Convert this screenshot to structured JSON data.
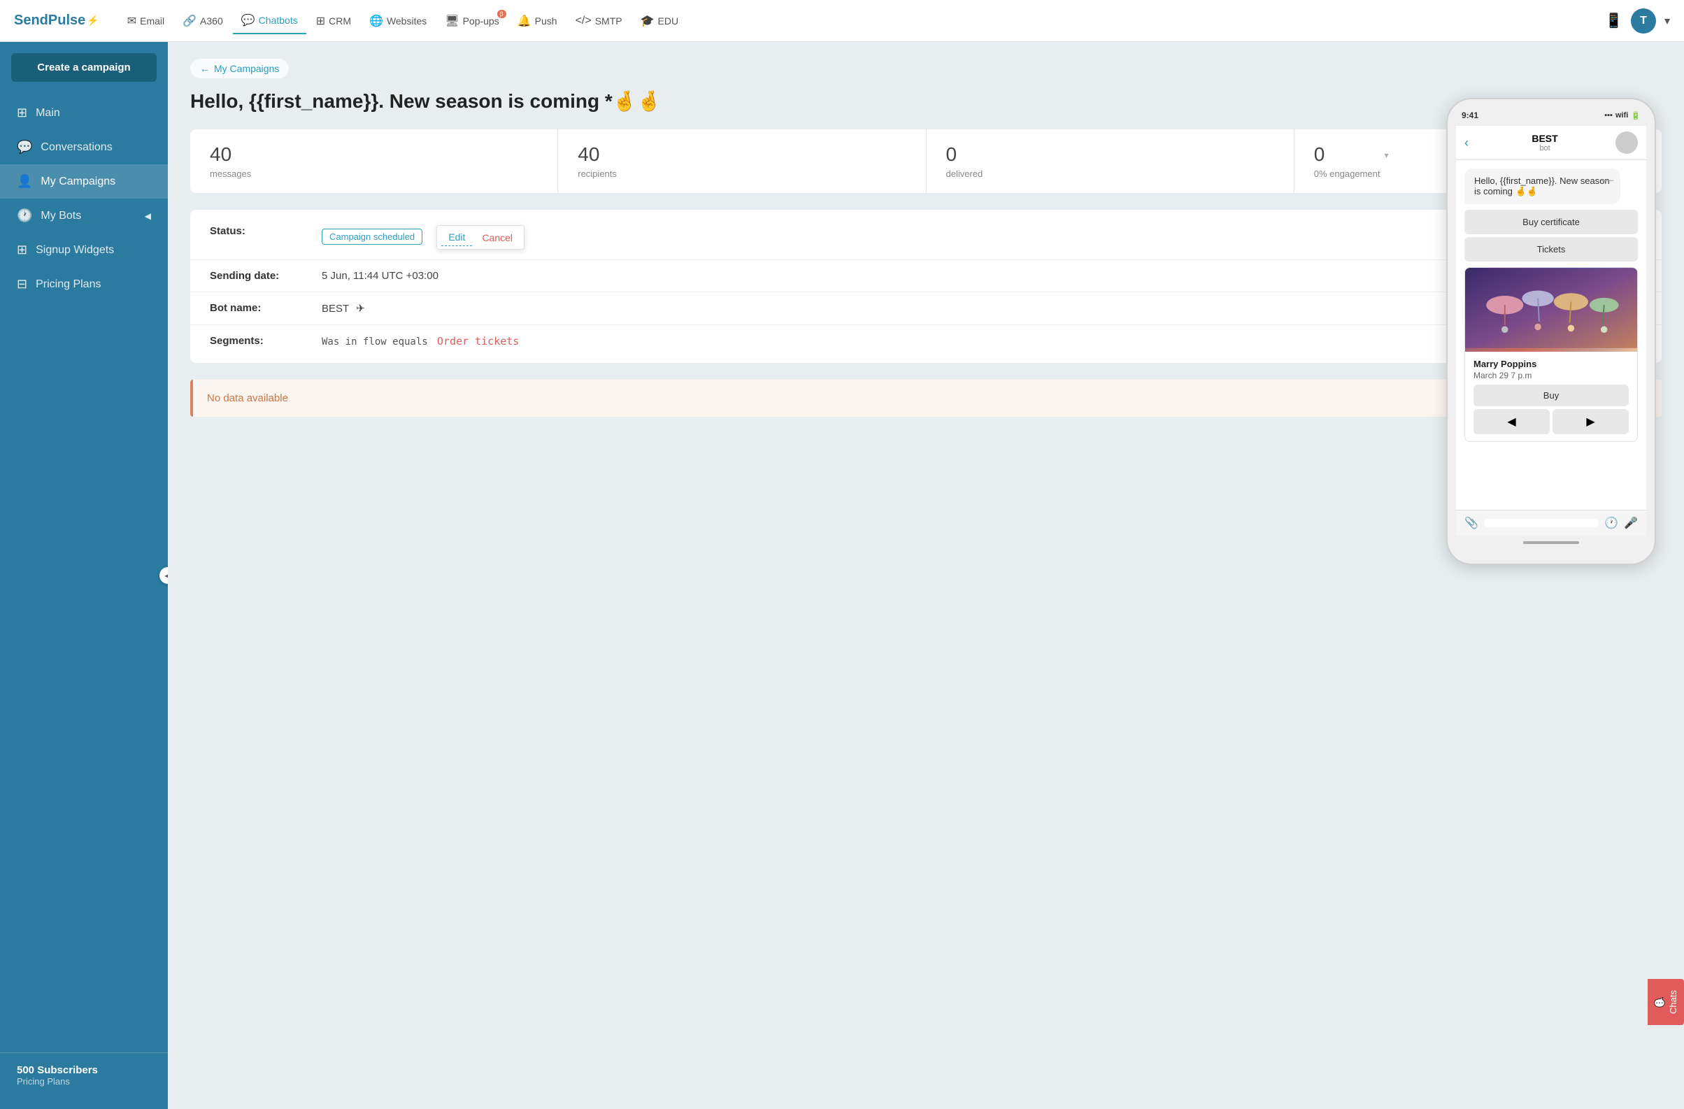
{
  "topnav": {
    "logo": "SendPulse",
    "logo_symbol": "⚡",
    "nav_items": [
      {
        "id": "email",
        "label": "Email",
        "icon": "✉",
        "active": false
      },
      {
        "id": "a360",
        "label": "A360",
        "icon": "🔗",
        "active": false
      },
      {
        "id": "chatbots",
        "label": "Chatbots",
        "icon": "💬",
        "active": true
      },
      {
        "id": "crm",
        "label": "CRM",
        "icon": "⊞",
        "active": false
      },
      {
        "id": "websites",
        "label": "Websites",
        "icon": "🌐",
        "active": false
      },
      {
        "id": "popups",
        "label": "Pop-ups",
        "icon": "🖥",
        "active": false,
        "beta": true
      },
      {
        "id": "push",
        "label": "Push",
        "icon": "🔔",
        "active": false
      },
      {
        "id": "smtp",
        "label": "SMTP",
        "icon": "</>",
        "active": false
      },
      {
        "id": "edu",
        "label": "EDU",
        "icon": "🎓",
        "active": false
      }
    ],
    "user_initial": "T"
  },
  "sidebar": {
    "create_button": "Create a campaign",
    "items": [
      {
        "id": "main",
        "label": "Main",
        "icon": "⊞"
      },
      {
        "id": "conversations",
        "label": "Conversations",
        "icon": "💬"
      },
      {
        "id": "my-campaigns",
        "label": "My Campaigns",
        "icon": "👤"
      },
      {
        "id": "my-bots",
        "label": "My Bots",
        "icon": "🕐",
        "has_arrow": true
      },
      {
        "id": "signup-widgets",
        "label": "Signup Widgets",
        "icon": "⊞"
      },
      {
        "id": "pricing-plans",
        "label": "Pricing Plans",
        "icon": "⊟"
      }
    ],
    "subscribers": "500 Subscribers",
    "pricing_link": "Pricing Plans"
  },
  "breadcrumb": {
    "arrow": "←",
    "label": "My Campaigns"
  },
  "campaign": {
    "title": "Hello, {{first_name}}. New season is coming *🤞🤞",
    "stats": {
      "messages": {
        "value": "40",
        "label": "messages"
      },
      "recipients": {
        "value": "40",
        "label": "recipients"
      },
      "delivered": {
        "value": "0",
        "label": "delivered"
      },
      "engagement": {
        "value": "0",
        "label": "0% engagement"
      }
    },
    "status_label": "Status:",
    "status_badge": "Campaign scheduled",
    "edit_label": "Edit",
    "cancel_label": "Cancel",
    "sending_date_label": "Sending date:",
    "sending_date_value": "5 Jun, 11:44 UTC +03:00",
    "bot_name_label": "Bot name:",
    "bot_name_value": "BEST",
    "segments_label": "Segments:",
    "segments_prefix": "Was in flow equals",
    "segments_highlight": "Order tickets",
    "no_data": "No data available"
  },
  "phone_preview": {
    "time": "9:41",
    "bot_name": "BEST",
    "bot_sub": "bot",
    "message": "Hello, {{first_name}}. New season is coming 🤞🤞",
    "dash": "—",
    "btn1": "Buy certificate",
    "btn2": "Tickets",
    "card_title": "Marry Poppins",
    "card_subtitle": "March 29 7 p.m",
    "buy_btn": "Buy",
    "nav_left": "◀",
    "nav_right": "▶"
  },
  "chats_btn": "Chats"
}
